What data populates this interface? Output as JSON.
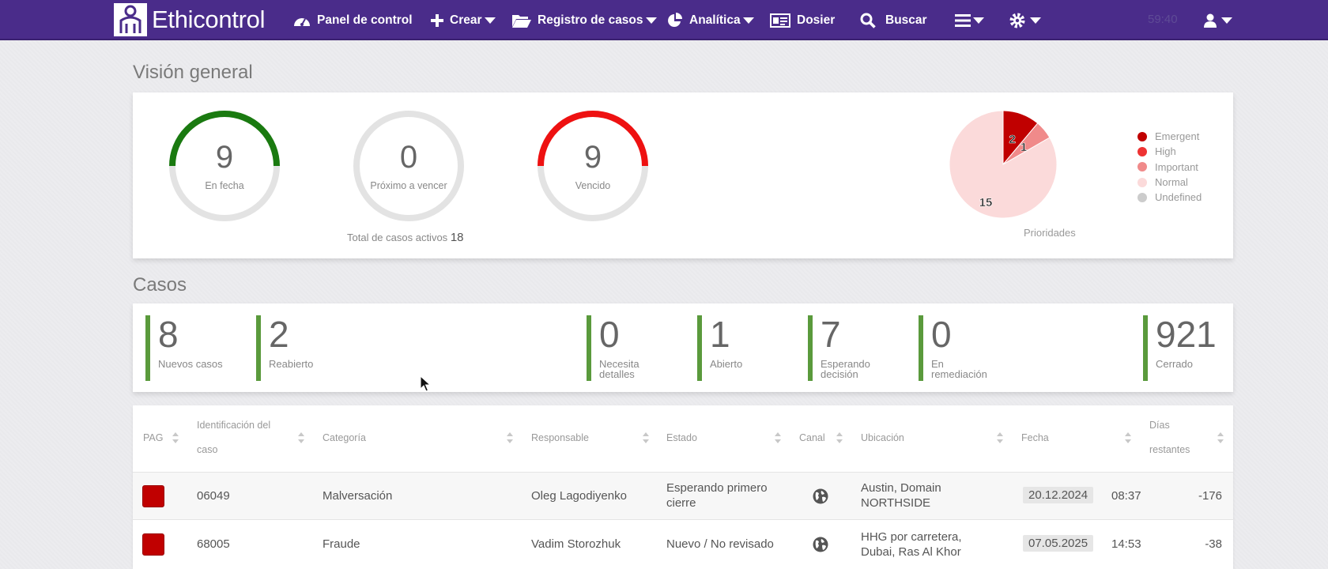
{
  "nav": {
    "brand": "Ethicontrol",
    "dashboard": "Panel de control",
    "create": "Crear",
    "case_registry": "Registro de casos",
    "analytics": "Analítica",
    "dossier": "Dosier",
    "search": "Buscar",
    "session_time": "59:40",
    "color": "#4a2c8a"
  },
  "overview": {
    "title": "Visión general",
    "gauges": [
      {
        "value": "9",
        "label": "En fecha",
        "color": "#1a7a10",
        "fill": 0.5
      },
      {
        "value": "0",
        "label": "Próximo a vencer",
        "color": "#e0e0e0",
        "fill": 0
      },
      {
        "value": "9",
        "label": "Vencido",
        "color": "#ee1111",
        "fill": 0.5
      }
    ],
    "total_label": "Total de casos activos",
    "total_value": "18",
    "priorities_label": "Prioridades",
    "legend": [
      {
        "label": "Emergent",
        "color": "#c00000"
      },
      {
        "label": "High",
        "color": "#ee3333"
      },
      {
        "label": "Important",
        "color": "#f08a8a"
      },
      {
        "label": "Normal",
        "color": "#fbdada"
      },
      {
        "label": "Undefined",
        "color": "#cccccc"
      }
    ]
  },
  "chart_data": {
    "type": "pie",
    "title": "Prioridades",
    "slices": [
      {
        "label": "Emergent",
        "value": 2,
        "color": "#c00000"
      },
      {
        "label": "Important",
        "value": 1,
        "color": "#f08a8a"
      },
      {
        "label": "Normal",
        "value": 15,
        "color": "#fbdada"
      }
    ],
    "legend_position": "right"
  },
  "cases": {
    "title": "Casos",
    "stats": [
      {
        "value": "8",
        "label": "Nuevos casos"
      },
      {
        "value": "2",
        "label": "Reabierto"
      },
      {
        "value": "0",
        "label": "Necesita detalles"
      },
      {
        "value": "1",
        "label": "Abierto"
      },
      {
        "value": "7",
        "label": "Esperando decisión"
      },
      {
        "value": "0",
        "label": "En remediación"
      },
      {
        "value": "921",
        "label": "Cerrado"
      }
    ]
  },
  "table": {
    "headers": {
      "pag": "PAG",
      "id": "Identificación del caso",
      "category": "Categoría",
      "owner": "Responsable",
      "status": "Estado",
      "channel": "Canal",
      "location": "Ubicación",
      "date": "Fecha",
      "days": "Días restantes"
    },
    "rows": [
      {
        "id": "06049",
        "category": "Malversación",
        "owner": "Oleg Lagodiyenko",
        "status": "Esperando primero cierre",
        "location": "Austin, Domain NORTHSIDE",
        "date": "20.12.2024",
        "time": "08:37",
        "days": "-176"
      },
      {
        "id": "68005",
        "category": "Fraude",
        "owner": "Vadim Storozhuk",
        "status": "Nuevo / No revisado",
        "location": "HHG por carretera, Dubai, Ras Al Khor",
        "date": "07.05.2025",
        "time": "14:53",
        "days": "-38"
      }
    ]
  }
}
